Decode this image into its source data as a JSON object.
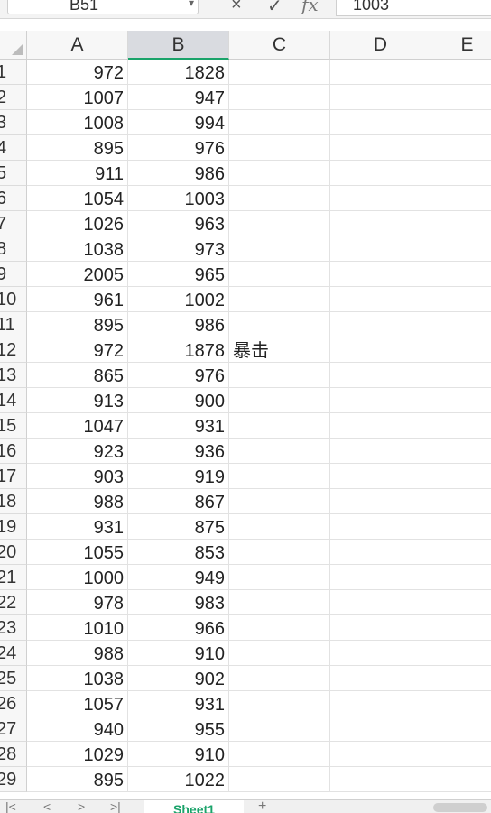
{
  "formula_bar": {
    "name_box": "B51",
    "cancel_icon": "×",
    "confirm_icon": "✓",
    "fx_label": "fx",
    "formula_value": "1003"
  },
  "columns": [
    "A",
    "B",
    "C",
    "D",
    "E"
  ],
  "selected_column": "B",
  "rows": [
    {
      "n": "1",
      "a": "972",
      "b": "1828",
      "c": ""
    },
    {
      "n": "2",
      "a": "1007",
      "b": "947",
      "c": ""
    },
    {
      "n": "3",
      "a": "1008",
      "b": "994",
      "c": ""
    },
    {
      "n": "4",
      "a": "895",
      "b": "976",
      "c": ""
    },
    {
      "n": "5",
      "a": "911",
      "b": "986",
      "c": ""
    },
    {
      "n": "6",
      "a": "1054",
      "b": "1003",
      "c": ""
    },
    {
      "n": "7",
      "a": "1026",
      "b": "963",
      "c": ""
    },
    {
      "n": "8",
      "a": "1038",
      "b": "973",
      "c": ""
    },
    {
      "n": "9",
      "a": "2005",
      "b": "965",
      "c": ""
    },
    {
      "n": "10",
      "a": "961",
      "b": "1002",
      "c": ""
    },
    {
      "n": "11",
      "a": "895",
      "b": "986",
      "c": ""
    },
    {
      "n": "12",
      "a": "972",
      "b": "1878",
      "c": "暴击"
    },
    {
      "n": "13",
      "a": "865",
      "b": "976",
      "c": ""
    },
    {
      "n": "14",
      "a": "913",
      "b": "900",
      "c": ""
    },
    {
      "n": "15",
      "a": "1047",
      "b": "931",
      "c": ""
    },
    {
      "n": "16",
      "a": "923",
      "b": "936",
      "c": ""
    },
    {
      "n": "17",
      "a": "903",
      "b": "919",
      "c": ""
    },
    {
      "n": "18",
      "a": "988",
      "b": "867",
      "c": ""
    },
    {
      "n": "19",
      "a": "931",
      "b": "875",
      "c": ""
    },
    {
      "n": "20",
      "a": "1055",
      "b": "853",
      "c": ""
    },
    {
      "n": "21",
      "a": "1000",
      "b": "949",
      "c": ""
    },
    {
      "n": "22",
      "a": "978",
      "b": "983",
      "c": ""
    },
    {
      "n": "23",
      "a": "1010",
      "b": "966",
      "c": ""
    },
    {
      "n": "24",
      "a": "988",
      "b": "910",
      "c": ""
    },
    {
      "n": "25",
      "a": "1038",
      "b": "902",
      "c": ""
    },
    {
      "n": "26",
      "a": "1057",
      "b": "931",
      "c": ""
    },
    {
      "n": "27",
      "a": "940",
      "b": "955",
      "c": ""
    },
    {
      "n": "28",
      "a": "1029",
      "b": "910",
      "c": ""
    },
    {
      "n": "29",
      "a": "895",
      "b": "1022",
      "c": ""
    }
  ],
  "tab_bar": {
    "first_icon": "|<",
    "prev_icon": "<",
    "next_icon": ">",
    "last_icon": ">|",
    "sheet_name": "Sheet1",
    "add_icon": "+"
  },
  "colors": {
    "accent": "#1aa36a",
    "selected_header": "#d9dbe0"
  }
}
